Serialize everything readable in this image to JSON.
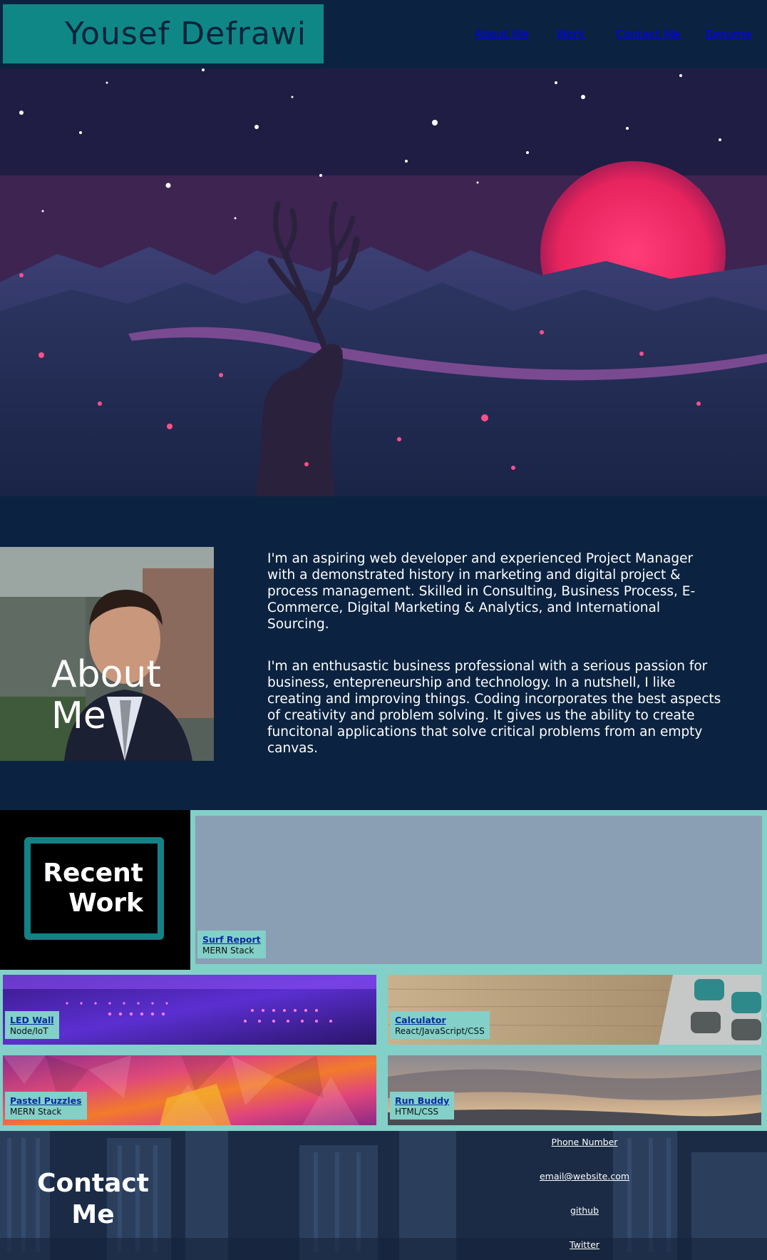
{
  "header": {
    "brand_name": "Yousef Defrawi",
    "nav": {
      "about": "About Me",
      "work": "Work",
      "contact": "Contact Me",
      "resume": "Resume"
    }
  },
  "about": {
    "title": "About Me",
    "paragraphs": [
      "I'm an aspiring web developer and experienced Project Manager with a demonstrated history in marketing and digital project & process management. Skilled in Consulting, Business Process, E-Commerce, Digital Marketing & Analytics, and International Sourcing.",
      "I'm an enthusastic business professional with a serious passion for business, entepreneurship and technology. In a nutshell, I like creating and improving things. Coding incorporates the best aspects of creativity and problem solving. It gives us the ability to create funcitonal applications that solve critical problems from an empty canvas."
    ]
  },
  "work": {
    "title_line1": "Recent",
    "title_line2": "Work",
    "projects": [
      {
        "name": "Surf Report",
        "stack": "MERN Stack"
      },
      {
        "name": "LED Wall",
        "stack": "Node/IoT"
      },
      {
        "name": "Calculator",
        "stack": "React/JavaScript/CSS"
      },
      {
        "name": "Pastel Puzzles",
        "stack": "MERN Stack"
      },
      {
        "name": "Run Buddy",
        "stack": "HTML/CSS"
      }
    ]
  },
  "contact": {
    "title_line1": "Contact",
    "title_line2": "Me",
    "links": [
      "Phone Number",
      "email@website.com",
      "github",
      "Twitter"
    ]
  },
  "colors": {
    "page_bg": "#0b2340",
    "brand_bg": "#108787",
    "work_bg": "#82d0c8",
    "work_border": "#138185",
    "link": "#0b2a9e"
  }
}
